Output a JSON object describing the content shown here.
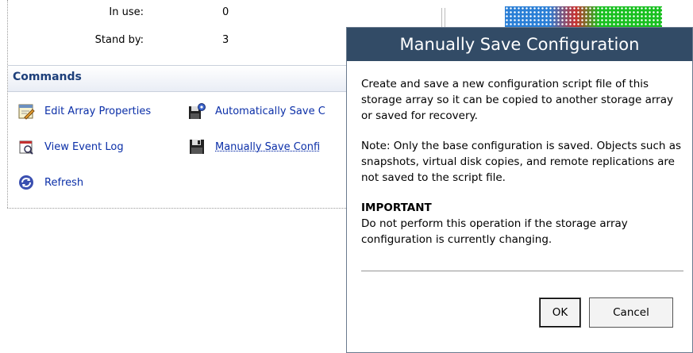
{
  "stats": {
    "in_use_label": "In use:",
    "in_use_value": "0",
    "stand_by_label": "Stand by:",
    "stand_by_value": "3"
  },
  "commands": {
    "header": "Commands",
    "items": [
      {
        "label": "Edit Array Properties",
        "icon": "edit-properties-icon"
      },
      {
        "label": "View Event Log",
        "icon": "event-log-icon"
      },
      {
        "label": "Refresh",
        "icon": "refresh-icon"
      },
      {
        "label": "Automatically Save C",
        "icon": "auto-save-icon"
      },
      {
        "label": "Manually Save Confi",
        "icon": "floppy-disk-icon"
      }
    ]
  },
  "dialog": {
    "title": "Manually Save Configuration",
    "paragraph1": "Create and save a new configuration script file of this storage array so it can be copied to another storage array or saved for recovery.",
    "paragraph2": "Note: Only the base configuration is saved. Objects such as snapshots, virtual disk copies, and remote replications are not saved to the script file.",
    "important_heading": "IMPORTANT",
    "important_text": "Do not perform this operation if the storage array configuration is currently changing.",
    "ok_label": "OK",
    "cancel_label": "Cancel"
  },
  "colors": {
    "dialog_title_bg": "#324b66",
    "link": "#0b2fa8",
    "header_text": "#1d3f7a"
  }
}
